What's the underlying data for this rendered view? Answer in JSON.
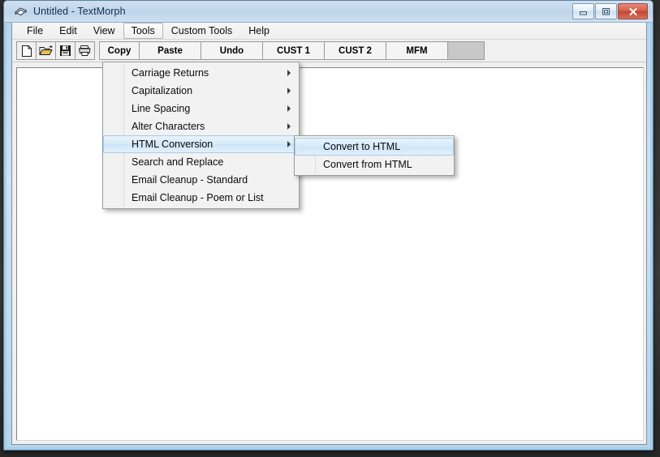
{
  "window": {
    "title": "Untitled - TextMorph",
    "app_icon": "textmorph-logo-icon",
    "controls": {
      "minimize_label": "Minimize",
      "maximize_label": "Maximize",
      "close_label": "Close"
    }
  },
  "menubar": {
    "items": [
      {
        "label": "File",
        "name": "menu-file",
        "active": false
      },
      {
        "label": "Edit",
        "name": "menu-edit",
        "active": false
      },
      {
        "label": "View",
        "name": "menu-view",
        "active": false
      },
      {
        "label": "Tools",
        "name": "menu-tools",
        "active": true
      },
      {
        "label": "Custom Tools",
        "name": "menu-custom-tools",
        "active": false
      },
      {
        "label": "Help",
        "name": "menu-help",
        "active": false
      }
    ]
  },
  "toolbar": {
    "icons": [
      {
        "name": "new-document-icon",
        "label": "New"
      },
      {
        "name": "open-folder-icon",
        "label": "Open"
      },
      {
        "name": "save-floppy-icon",
        "label": "Save"
      },
      {
        "name": "print-icon",
        "label": "Print"
      }
    ],
    "buttons": [
      {
        "label": "Copy",
        "name": "toolbar-copy-button"
      },
      {
        "label": "Paste",
        "name": "toolbar-paste-button"
      },
      {
        "label": "Undo",
        "name": "toolbar-undo-button"
      },
      {
        "label": "CUST 1",
        "name": "toolbar-cust1-button"
      },
      {
        "label": "CUST 2",
        "name": "toolbar-cust2-button"
      },
      {
        "label": "MFM",
        "name": "toolbar-mfm-button"
      }
    ]
  },
  "editor": {
    "content": "",
    "placeholder": ""
  },
  "tools_menu": {
    "items": [
      {
        "label": "Carriage Returns",
        "submenu": true,
        "highlighted": false
      },
      {
        "label": "Capitalization",
        "submenu": true,
        "highlighted": false
      },
      {
        "label": "Line Spacing",
        "submenu": true,
        "highlighted": false
      },
      {
        "label": "Alter Characters",
        "submenu": true,
        "highlighted": false
      },
      {
        "label": "HTML Conversion",
        "submenu": true,
        "highlighted": true
      },
      {
        "label": "Search and Replace",
        "submenu": false,
        "highlighted": false
      },
      {
        "label": "Email Cleanup - Standard",
        "submenu": false,
        "highlighted": false
      },
      {
        "label": "Email Cleanup - Poem or List",
        "submenu": false,
        "highlighted": false
      }
    ]
  },
  "html_submenu": {
    "items": [
      {
        "label": "Convert to HTML",
        "highlighted": true
      },
      {
        "label": "Convert from HTML",
        "highlighted": false
      }
    ]
  },
  "colors": {
    "titlebar": "#c4d8ec",
    "close_button": "#c9503b",
    "menu_highlight": "#d6eafa",
    "menu_highlight_border": "#a8cce5",
    "client_background": "#f0f0f0",
    "editor_background": "#ffffff"
  }
}
